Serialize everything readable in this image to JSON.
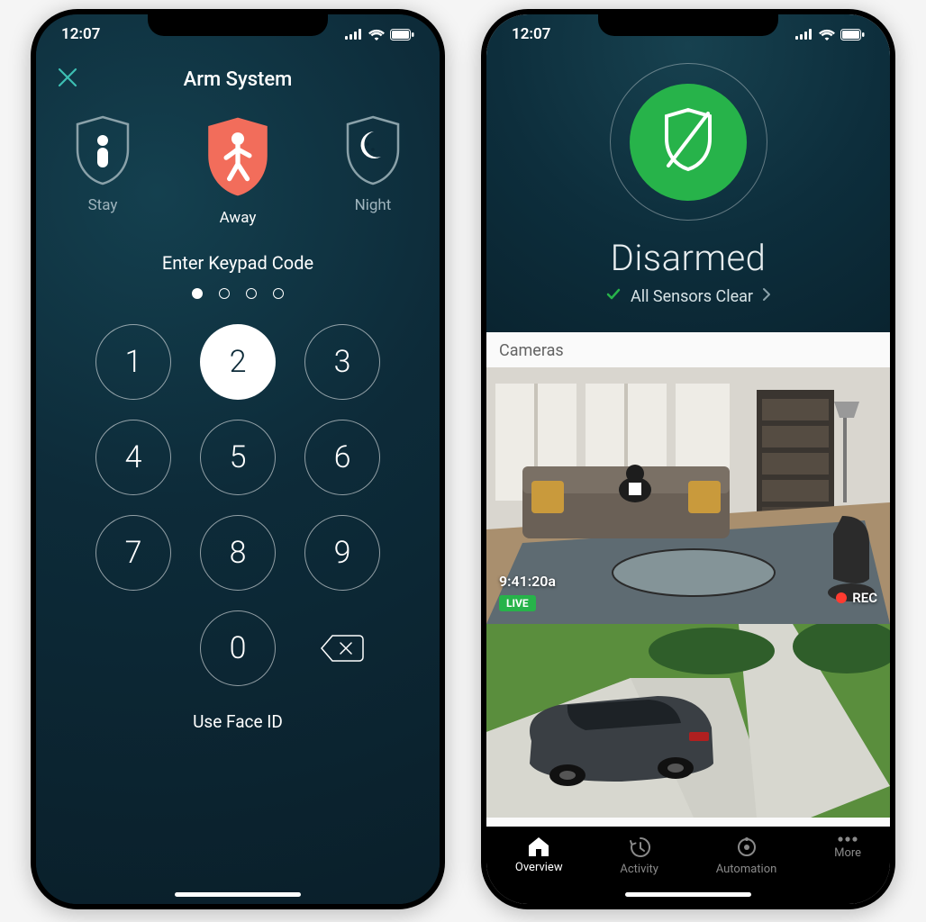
{
  "status": {
    "time": "12:07"
  },
  "arm": {
    "title": "Arm System",
    "modes": {
      "stay": {
        "label": "Stay"
      },
      "away": {
        "label": "Away",
        "selected": true
      },
      "night": {
        "label": "Night"
      }
    },
    "prompt": "Enter Keypad Code",
    "code_length": 4,
    "digits_entered": 1,
    "keypad": {
      "1": "1",
      "2": "2",
      "3": "3",
      "4": "4",
      "5": "5",
      "6": "6",
      "7": "7",
      "8": "8",
      "9": "9",
      "0": "0",
      "pressed": "2"
    },
    "faceid_label": "Use Face ID"
  },
  "dashboard": {
    "status_text": "Disarmed",
    "sensors_text": "All Sensors Clear",
    "cameras_label": "Cameras",
    "camera1": {
      "timestamp": "9:41:20a",
      "live_badge": "LIVE",
      "rec_badge": "REC"
    },
    "tabs": {
      "overview": {
        "label": "Overview",
        "active": true
      },
      "activity": {
        "label": "Activity"
      },
      "automation": {
        "label": "Automation"
      },
      "more": {
        "label": "More"
      }
    }
  },
  "colors": {
    "accent_teal": "#3dbfb3",
    "away_orange": "#f26d5b",
    "ok_green": "#27b34a",
    "rec_red": "#ff3b30"
  }
}
